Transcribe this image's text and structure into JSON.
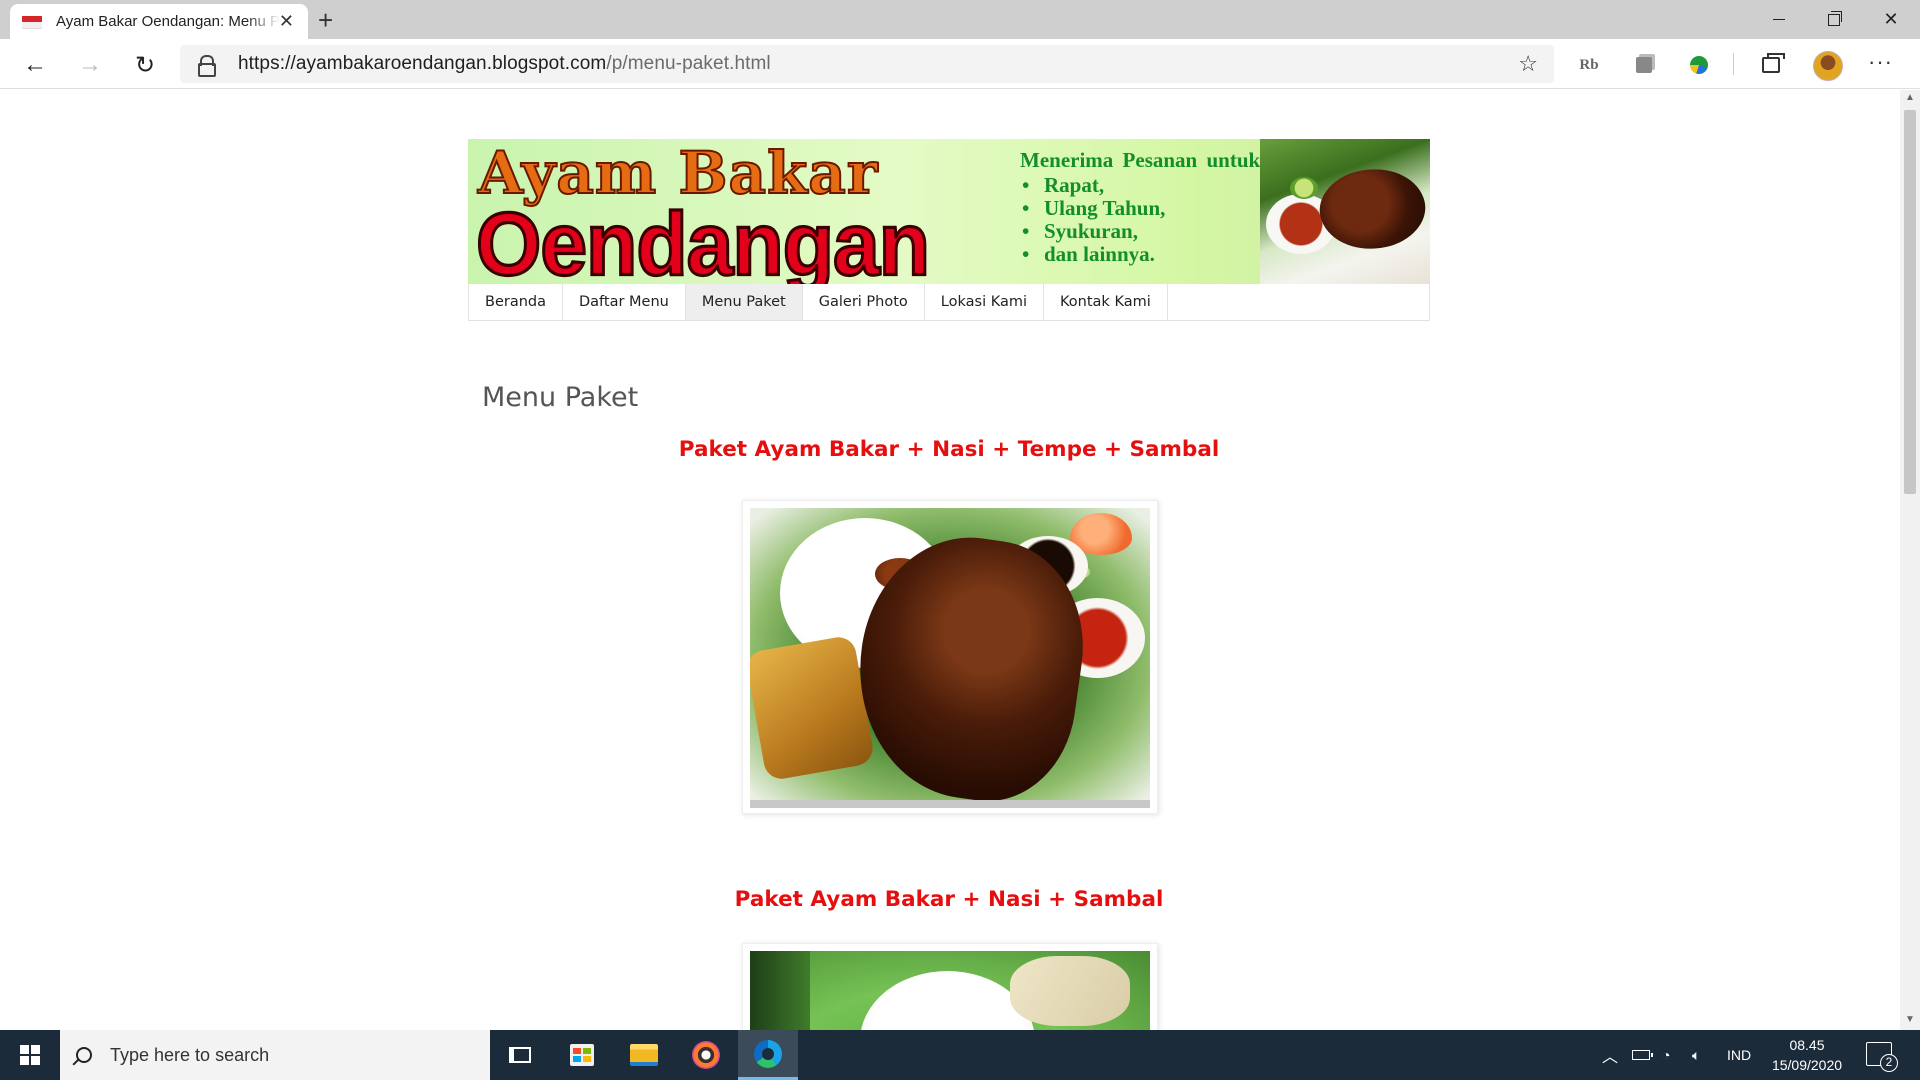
{
  "browser": {
    "tab_title": "Ayam Bakar Oendangan: Menu Paket",
    "tab_close": "✕",
    "new_tab": "+",
    "url_host": "https://ayambakaroendangan.blogspot.com",
    "url_path": "/p/menu-paket.html",
    "more_label": "···"
  },
  "banner": {
    "logo_line1": "Ayam Bakar",
    "logo_line2": "Oendangan",
    "order_heading": "Menerima Pesanan untuk:",
    "order_items": [
      "Rapat,",
      "Ulang Tahun,",
      "Syukuran,",
      "dan lainnya."
    ]
  },
  "nav": {
    "items": [
      "Beranda",
      "Daftar Menu",
      "Menu Paket",
      "Galeri Photo",
      "Lokasi Kami",
      "Kontak Kami"
    ],
    "active": "Menu Paket"
  },
  "page": {
    "title": "Menu Paket",
    "packages": [
      "Paket Ayam Bakar + Nasi + Tempe + Sambal",
      "Paket Ayam Bakar + Nasi +  Sambal"
    ]
  },
  "taskbar": {
    "search_placeholder": "Type here to search",
    "language": "IND",
    "time": "08.45",
    "date": "15/09/2020",
    "notification_count": "2"
  },
  "colors": {
    "package_title": "#e60f0f",
    "taskbar": "#1c2b3a",
    "order_text": "#138e2a"
  }
}
